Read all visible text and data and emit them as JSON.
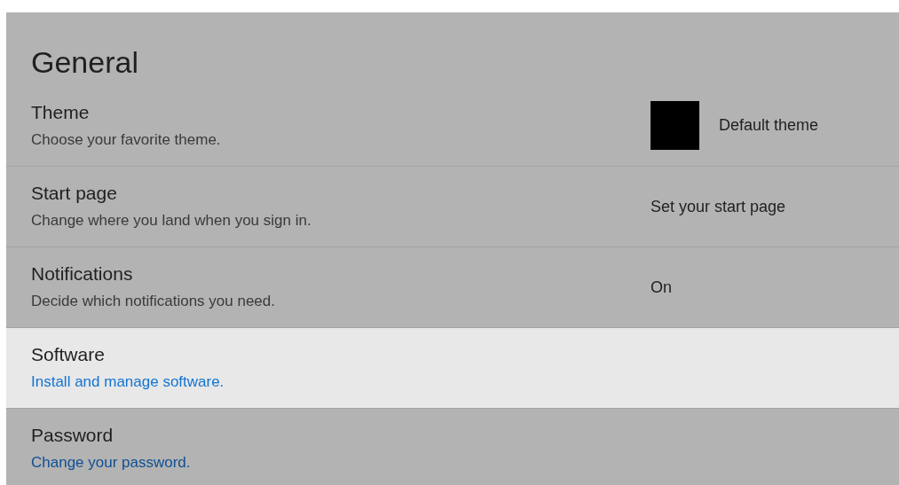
{
  "heading": "General",
  "items": [
    {
      "title": "Theme",
      "description": "Choose your favorite theme.",
      "selected": false,
      "value": {
        "kind": "swatch",
        "color": "#000000",
        "label": "Default theme"
      }
    },
    {
      "title": "Start page",
      "description": "Change where you land when you sign in.",
      "selected": false,
      "value": {
        "kind": "text",
        "label": "Set your start page"
      }
    },
    {
      "title": "Notifications",
      "description": "Decide which notifications you need.",
      "selected": false,
      "value": {
        "kind": "text",
        "label": "On"
      }
    },
    {
      "title": "Software",
      "link": "Install and manage software.",
      "selected": true
    },
    {
      "title": "Password",
      "link": "Change your password.",
      "selected": false
    }
  ]
}
